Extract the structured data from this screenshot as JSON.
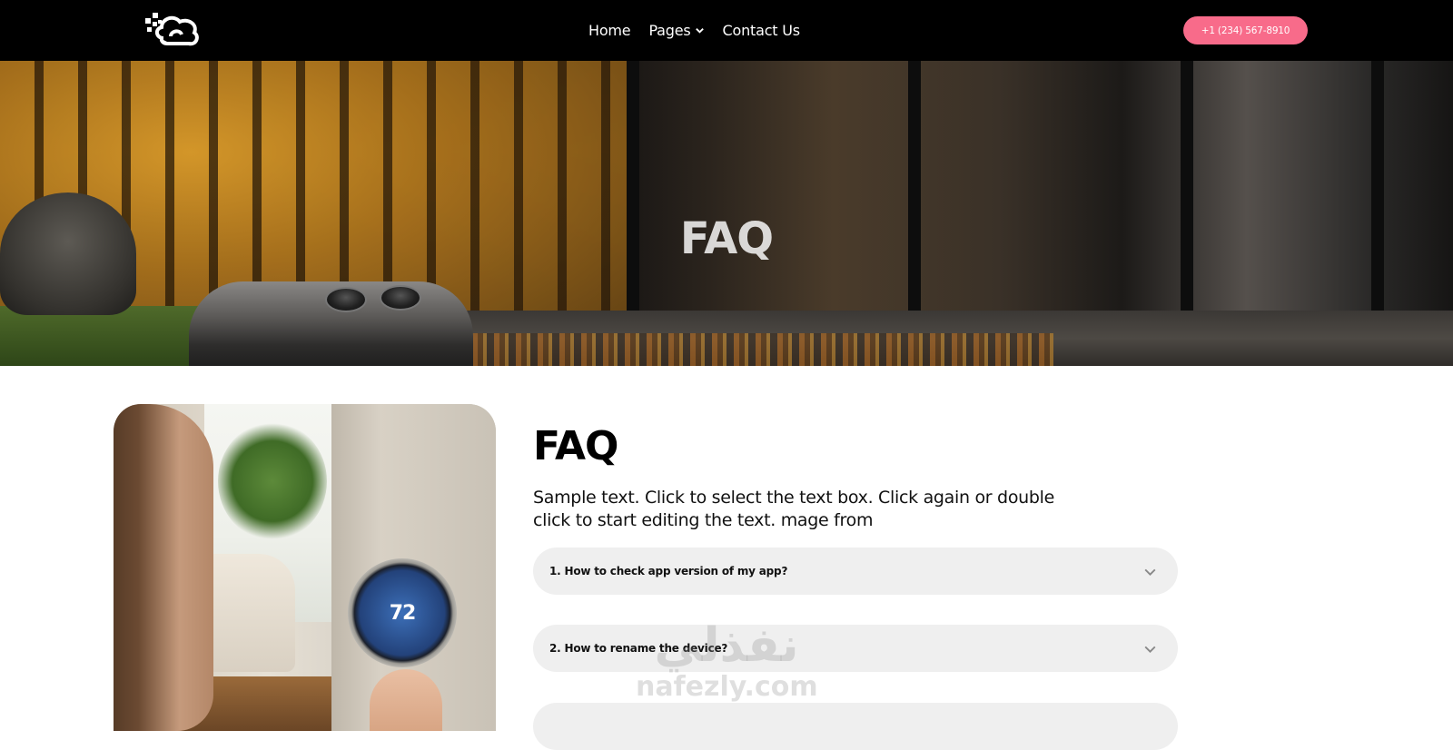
{
  "nav": {
    "items": [
      {
        "label": "Home"
      },
      {
        "label": "Pages"
      },
      {
        "label": "Contact Us"
      }
    ],
    "phone": "+1 (234) 567-8910"
  },
  "hero": {
    "title": "FAQ"
  },
  "faq": {
    "heading": "FAQ",
    "intro": "Sample text. Click to select the text box. Click again or double click to start editing the text. mage from",
    "items": [
      {
        "question": "1. How to check app version of my app?"
      },
      {
        "question": "2. How to rename the device?"
      }
    ]
  },
  "thermostat": {
    "temperature": "72"
  },
  "watermark": {
    "arabic": "نفذلي",
    "latin": "nafezly.com"
  },
  "colors": {
    "nav_bg": "#000000",
    "accent_pink": "#f86b8a",
    "faq_item_bg": "#efefef"
  }
}
